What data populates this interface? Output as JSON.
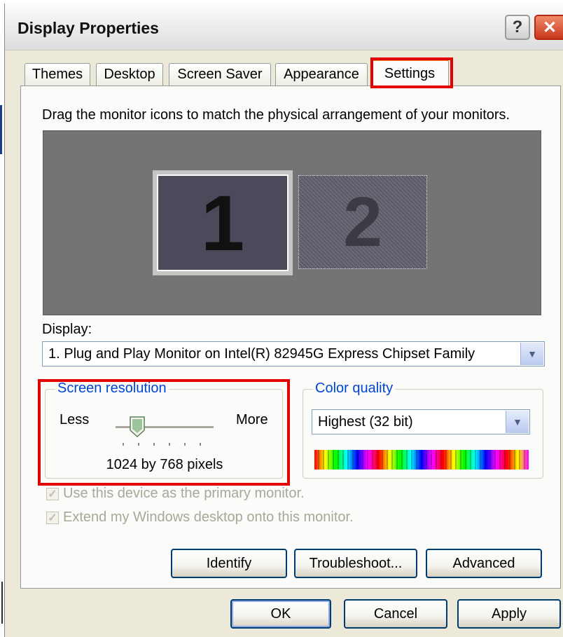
{
  "window": {
    "title": "Display Properties",
    "help_label": "?",
    "close_label": "✕"
  },
  "tabs": [
    {
      "label": "Themes"
    },
    {
      "label": "Desktop"
    },
    {
      "label": "Screen Saver"
    },
    {
      "label": "Appearance"
    },
    {
      "label": "Settings",
      "active": true
    }
  ],
  "settings": {
    "instruction": "Drag the monitor icons to match the physical arrangement of your monitors.",
    "monitors": [
      {
        "number": "1",
        "state": "selected"
      },
      {
        "number": "2",
        "state": "inactive"
      }
    ],
    "display_label": "Display:",
    "display_value": "1. Plug and Play Monitor on Intel(R) 82945G Express Chipset Family",
    "screen_resolution": {
      "title": "Screen resolution",
      "less_label": "Less",
      "more_label": "More",
      "value_text": "1024 by 768 pixels",
      "slider_fraction": 0.2
    },
    "color_quality": {
      "title": "Color quality",
      "selected": "Highest (32 bit)"
    },
    "checkboxes": [
      {
        "label": "Use this device as the primary monitor.",
        "checked": true,
        "enabled": false
      },
      {
        "label": "Extend my Windows desktop onto this monitor.",
        "checked": true,
        "enabled": false
      }
    ],
    "buttons": {
      "identify": "Identify",
      "troubleshoot": "Troubleshoot...",
      "advanced": "Advanced"
    }
  },
  "footer": {
    "ok": "OK",
    "cancel": "Cancel",
    "apply": "Apply"
  },
  "colors": {
    "highlight_red": "#e50000",
    "group_title_blue": "#0046d5",
    "dialog_bg": "#ece9d8"
  }
}
